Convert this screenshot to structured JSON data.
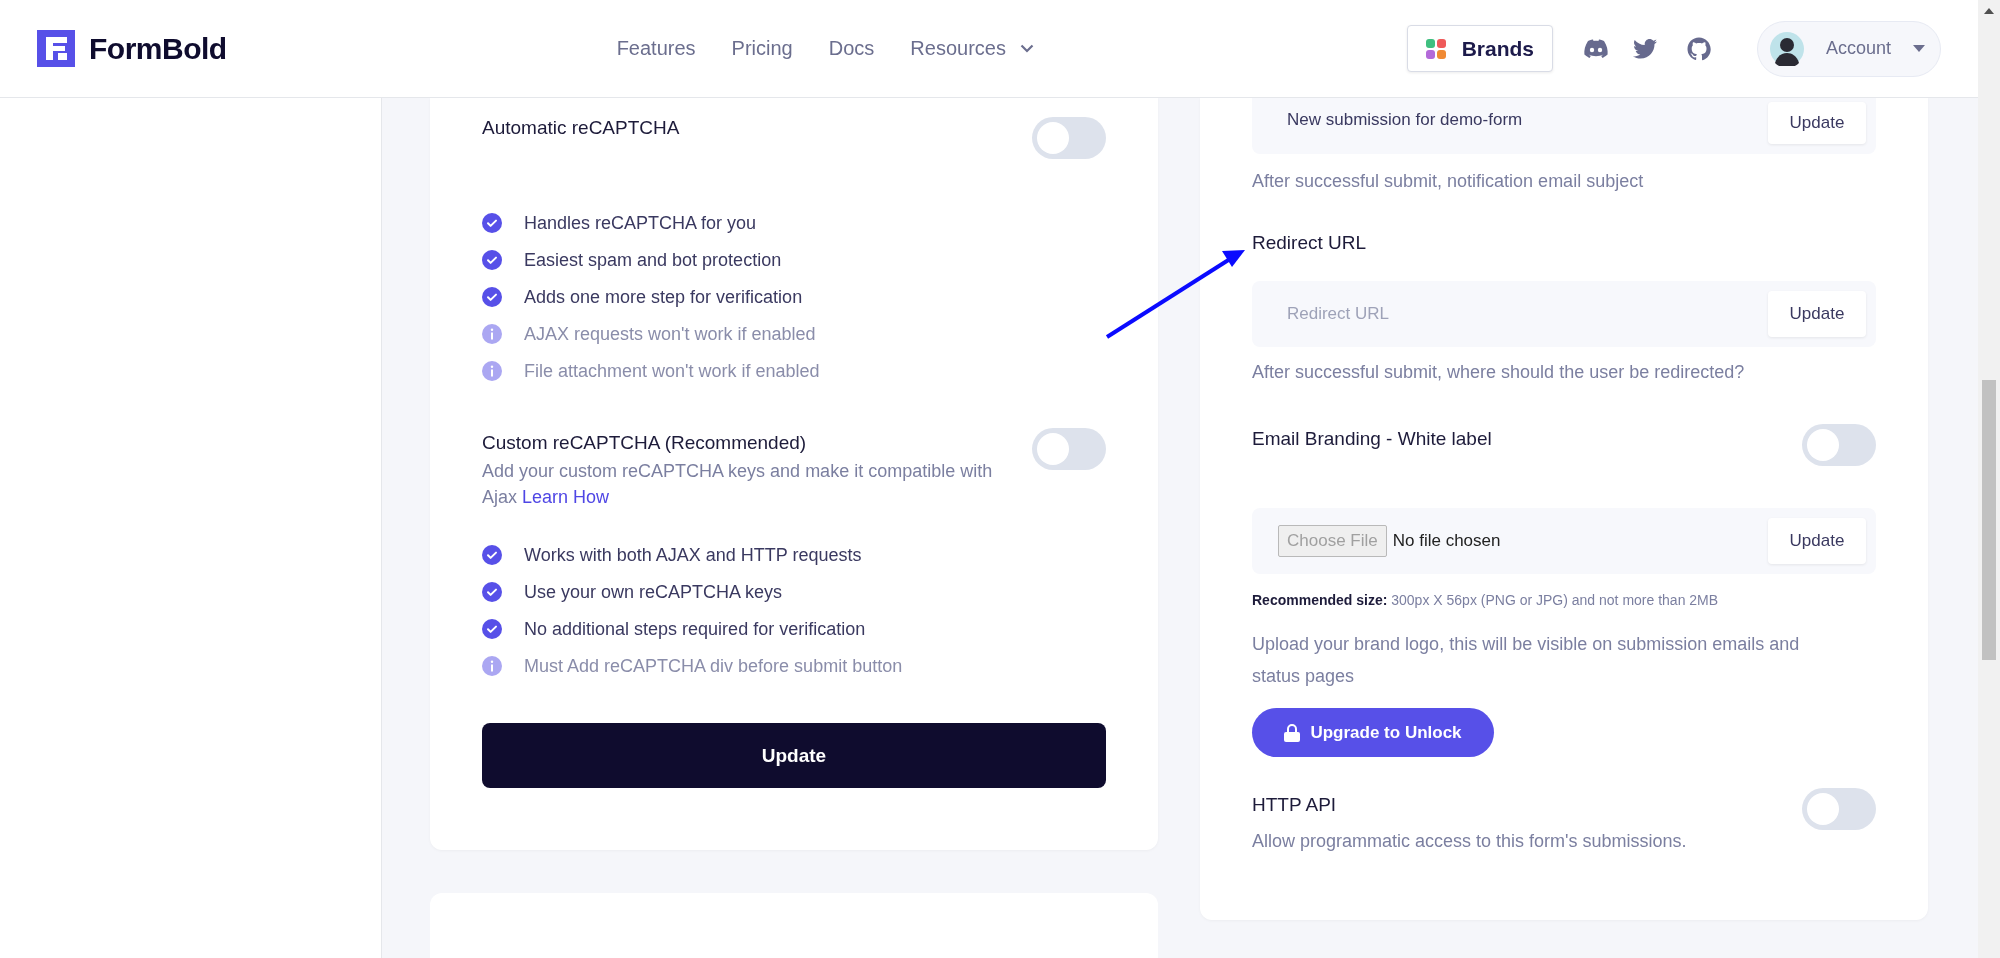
{
  "header": {
    "logo": "FormBold",
    "nav": [
      {
        "label": "Features",
        "has_menu": false
      },
      {
        "label": "Pricing",
        "has_menu": false
      },
      {
        "label": "Docs",
        "has_menu": false
      },
      {
        "label": "Resources",
        "has_menu": true
      }
    ],
    "brands_button": "Brands",
    "account_button": "Account"
  },
  "left_card": {
    "sections": [
      {
        "title": "Automatic reCAPTCHA",
        "enabled": false,
        "features": [
          {
            "text": "Handles reCAPTCHA for you",
            "kind": "check"
          },
          {
            "text": "Easiest spam and bot protection",
            "kind": "check"
          },
          {
            "text": "Adds one more step for verification",
            "kind": "check"
          },
          {
            "text": "AJAX requests won't work if enabled",
            "kind": "info"
          },
          {
            "text": "File attachment won't work if enabled",
            "kind": "info"
          }
        ]
      },
      {
        "title": "Custom reCAPTCHA (Recommended)",
        "enabled": false,
        "description": "Add your custom reCAPTCHA keys and make it compatible with Ajax",
        "link": "Learn How",
        "features": [
          {
            "text": "Works with both AJAX and HTTP requests",
            "kind": "check"
          },
          {
            "text": "Use your own reCAPTCHA keys",
            "kind": "check"
          },
          {
            "text": "No additional steps required for verification",
            "kind": "check"
          },
          {
            "text": "Must Add reCAPTCHA div before submit button",
            "kind": "info"
          }
        ]
      }
    ],
    "update_button": "Update"
  },
  "right_card": {
    "subject": {
      "value": "New submission for demo-form",
      "button": "Update",
      "help": "After successful submit, notification email subject"
    },
    "redirect": {
      "label": "Redirect URL",
      "placeholder": "Redirect URL",
      "button": "Update",
      "help": "After successful submit, where should the user be redirected?"
    },
    "branding": {
      "title": "Email Branding - White label",
      "enabled": false,
      "file_button": "Choose File",
      "file_status": "No file chosen",
      "button": "Update",
      "recommended": "**Recommended size:** 300px X 56px (PNG or JPG) and not more than 2MB",
      "help": "Upload your brand logo, this will be visible on submission emails and status pages",
      "upgrade_button": "Upgrade to Unlock"
    },
    "http_api": {
      "title": "HTTP API",
      "enabled": false,
      "description": "Allow programmatic access to this form's submissions."
    }
  }
}
